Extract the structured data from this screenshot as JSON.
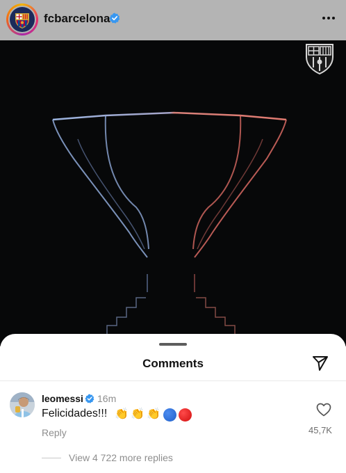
{
  "post": {
    "username": "fcbarcelona",
    "verified": true,
    "image_semantic": "trophy-outline-on-dark-background"
  },
  "comments_sheet": {
    "title": "Comments",
    "comment": {
      "username": "leomessi",
      "verified": true,
      "time": "16m",
      "text": "Felicidades!!!",
      "emoji": [
        "clap",
        "clap",
        "clap",
        "blue-circle",
        "red-circle"
      ],
      "reply_label": "Reply",
      "like_count": "45,7K",
      "view_replies_label": "View 4 722 more replies"
    }
  },
  "colors": {
    "header_bg": "#b4b4b4",
    "image_bg": "#070809",
    "verified_blue": "#3897f0",
    "secondary_text": "#8e8e8e",
    "trophy_blue": "#8ea9d8",
    "trophy_red": "#d86a63"
  }
}
